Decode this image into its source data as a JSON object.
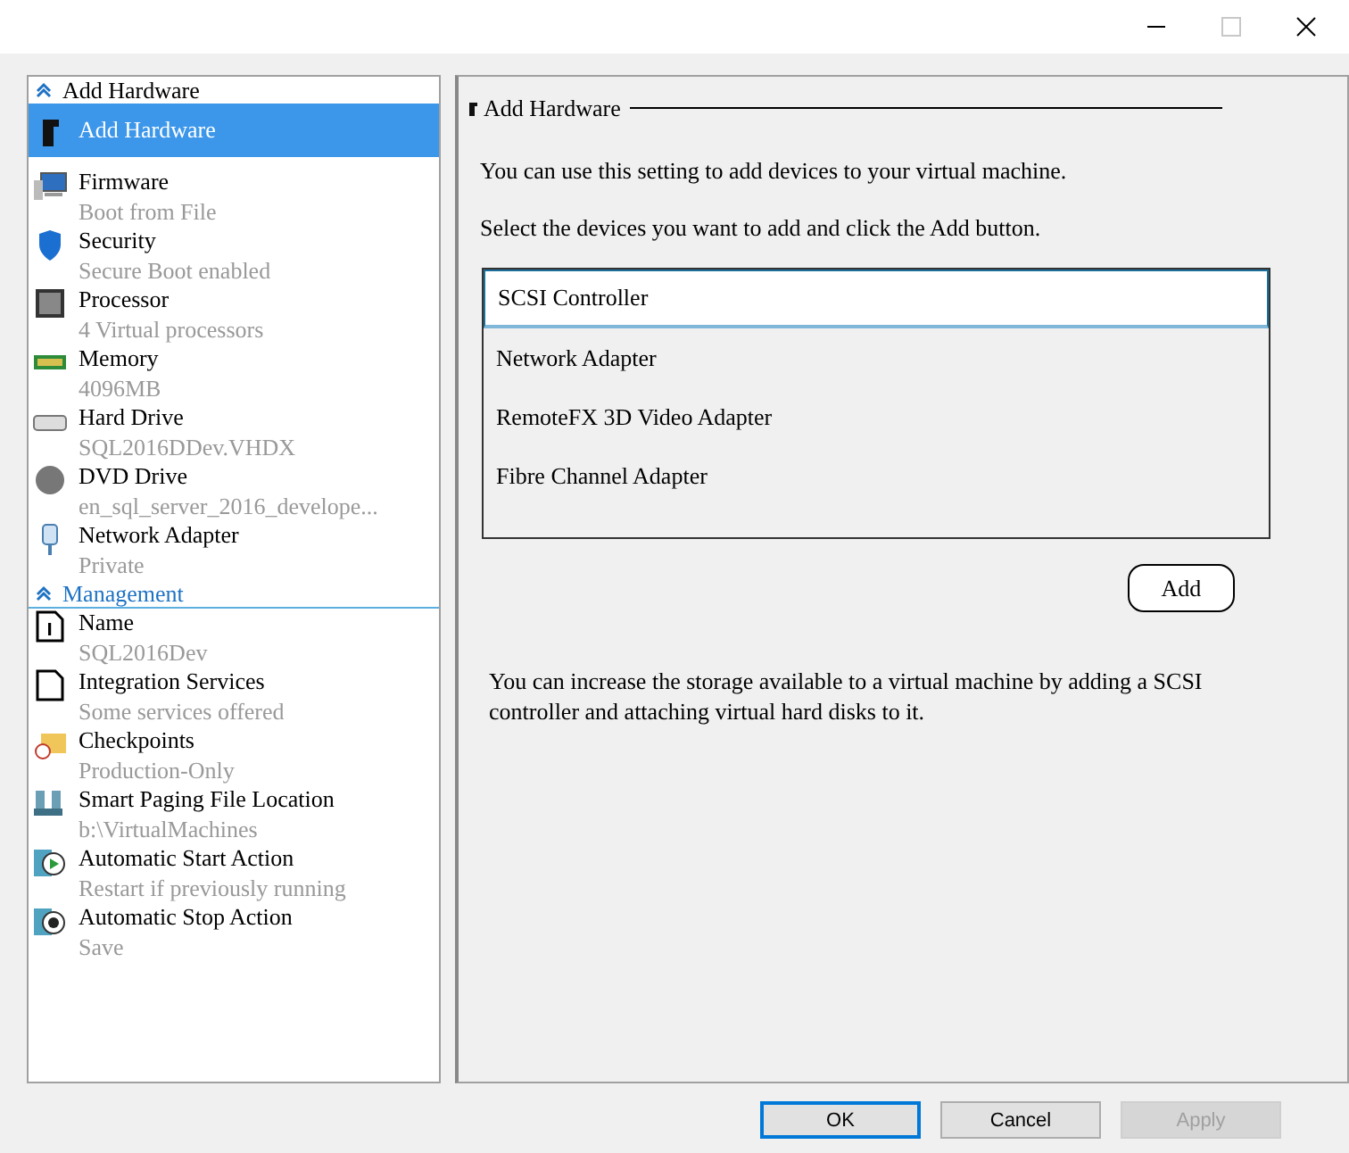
{
  "title_bar": {
    "maximize_disabled": true
  },
  "sidebar": {
    "sections": [
      {
        "title": "Add Hardware",
        "expanded": true,
        "items": [
          {
            "kind": "add",
            "name": "Add Hardware",
            "selected": true
          },
          {
            "kind": "firmware",
            "name": "Firmware",
            "detail": "Boot from File",
            "selected": false
          },
          {
            "kind": "security",
            "name": "Security",
            "detail": "Secure Boot enabled",
            "selected": false
          },
          {
            "kind": "processor",
            "name": "Processor",
            "detail": "4 Virtual processors",
            "selected": false
          },
          {
            "kind": "memory",
            "name": "Memory",
            "detail": "4096MB",
            "selected": false
          },
          {
            "kind": "disk",
            "name": "Hard Drive",
            "detail": "SQL2016DDev.VHDX",
            "selected": false
          },
          {
            "kind": "dvd",
            "name": "DVD Drive",
            "detail": "en_sql_server_2016_develope...",
            "selected": false
          },
          {
            "kind": "network",
            "name": "Network Adapter",
            "detail": "Private",
            "selected": false
          }
        ]
      },
      {
        "title": "Management",
        "expanded": true,
        "items": [
          {
            "kind": "info",
            "name": "Name",
            "detail": "SQL2016Dev",
            "selected": false
          },
          {
            "kind": "page",
            "name": "Integration Services",
            "detail": "Some services offered",
            "selected": false
          },
          {
            "kind": "checkpoint",
            "name": "Checkpoints",
            "detail": "Production-Only",
            "selected": false
          },
          {
            "kind": "paging",
            "name": "Smart Paging File Location",
            "detail": "b:\\VirtualMachines",
            "selected": false
          },
          {
            "kind": "start",
            "name": "Automatic Start Action",
            "detail": "Restart if previously running",
            "selected": false
          },
          {
            "kind": "stop",
            "name": "Automatic Stop Action",
            "detail": "Save",
            "selected": false
          }
        ]
      }
    ]
  },
  "panel": {
    "title": "Add Hardware",
    "intro": "You can use this setting to add devices to your virtual machine.",
    "instruction": "Select the devices you want to add and click the Add button.",
    "devices": [
      {
        "label": "SCSI Controller",
        "selected": true
      },
      {
        "label": "Network Adapter",
        "selected": false
      },
      {
        "label": "RemoteFX 3D Video Adapter",
        "selected": false
      },
      {
        "label": "Fibre Channel Adapter",
        "selected": false
      }
    ],
    "add_button": "Add",
    "note": "You can increase the storage available to a virtual machine by adding a SCSI controller and attaching virtual hard disks to it."
  },
  "buttons": [
    {
      "label": "OK",
      "default": true,
      "disabled": false
    },
    {
      "label": "Cancel",
      "default": false,
      "disabled": false
    },
    {
      "label": "Apply",
      "default": false,
      "disabled": true
    }
  ]
}
